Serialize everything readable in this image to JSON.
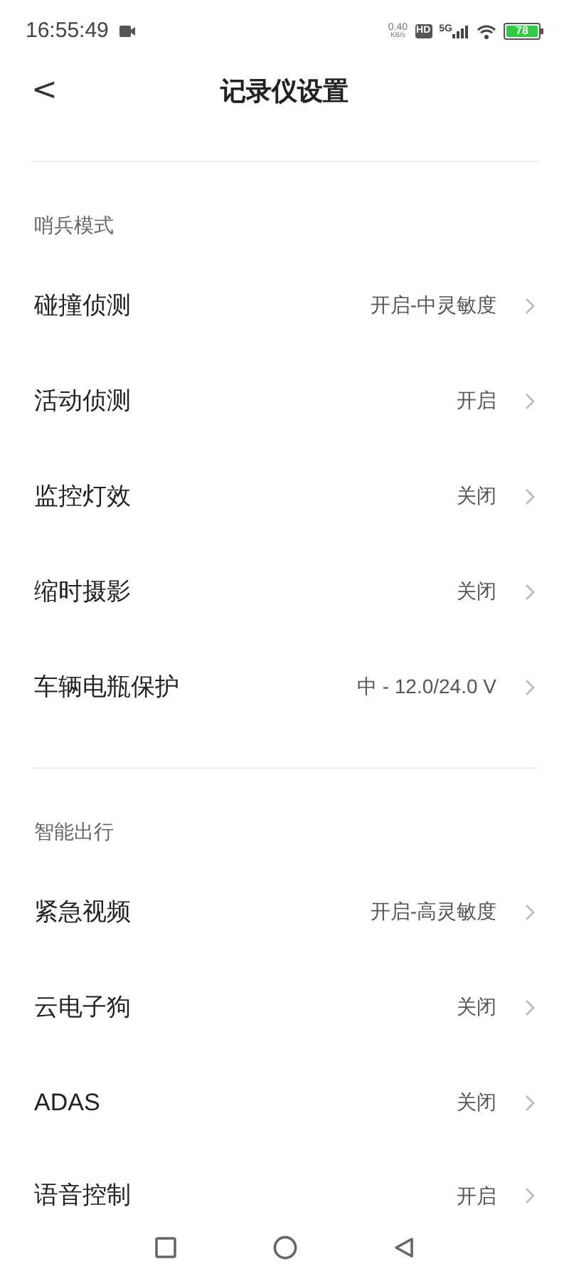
{
  "status_bar": {
    "time": "16:55:49",
    "speed_value": "0.40",
    "speed_unit": "KB/s",
    "hd": "HD",
    "network": "5G",
    "battery": "78"
  },
  "header": {
    "back": "<",
    "title": "记录仪设置"
  },
  "sections": [
    {
      "title": "哨兵模式",
      "items": [
        {
          "label": "碰撞侦测",
          "value": "开启-中灵敏度"
        },
        {
          "label": "活动侦测",
          "value": "开启"
        },
        {
          "label": "监控灯效",
          "value": "关闭"
        },
        {
          "label": "缩时摄影",
          "value": "关闭"
        },
        {
          "label": "车辆电瓶保护",
          "value": "中 - 12.0/24.0 V"
        }
      ]
    },
    {
      "title": "智能出行",
      "items": [
        {
          "label": "紧急视频",
          "value": "开启-高灵敏度"
        },
        {
          "label": "云电子狗",
          "value": "关闭"
        },
        {
          "label": "ADAS",
          "value": "关闭"
        },
        {
          "label": "语音控制",
          "value": "开启"
        }
      ]
    }
  ]
}
